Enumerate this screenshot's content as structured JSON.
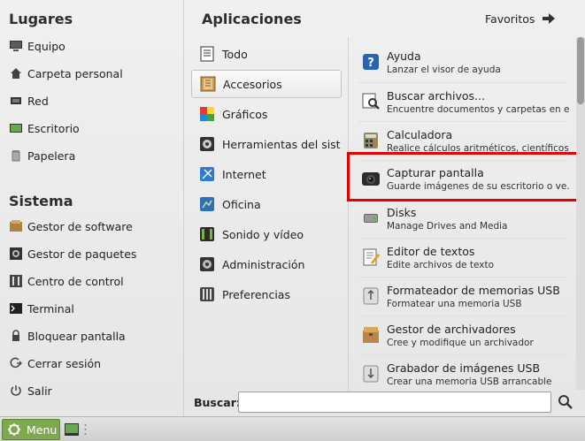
{
  "places": {
    "title": "Lugares",
    "items": [
      {
        "label": "Equipo",
        "icon": "computer-icon"
      },
      {
        "label": "Carpeta personal",
        "icon": "home-icon"
      },
      {
        "label": "Red",
        "icon": "network-icon"
      },
      {
        "label": "Escritorio",
        "icon": "desktop-icon"
      },
      {
        "label": "Papelera",
        "icon": "trash-icon"
      }
    ]
  },
  "system": {
    "title": "Sistema",
    "items": [
      {
        "label": "Gestor de software",
        "icon": "software-manager-icon"
      },
      {
        "label": "Gestor de paquetes",
        "icon": "package-manager-icon"
      },
      {
        "label": "Centro de control",
        "icon": "control-center-icon"
      },
      {
        "label": "Terminal",
        "icon": "terminal-icon"
      },
      {
        "label": "Bloquear pantalla",
        "icon": "lock-icon"
      },
      {
        "label": "Cerrar sesión",
        "icon": "logout-icon"
      },
      {
        "label": "Salir",
        "icon": "power-icon"
      }
    ]
  },
  "apps_header": {
    "title": "Aplicaciones",
    "favorites_label": "Favoritos"
  },
  "categories": [
    {
      "label": "Todo",
      "icon": "all-apps-icon"
    },
    {
      "label": "Accesorios",
      "icon": "accessories-icon",
      "selected": true
    },
    {
      "label": "Gráficos",
      "icon": "graphics-icon"
    },
    {
      "label": "Herramientas del sist...",
      "icon": "system-tools-icon"
    },
    {
      "label": "Internet",
      "icon": "internet-icon"
    },
    {
      "label": "Oficina",
      "icon": "office-icon"
    },
    {
      "label": "Sonido y vídeo",
      "icon": "sound-video-icon"
    },
    {
      "label": "Administración",
      "icon": "administration-icon"
    },
    {
      "label": "Preferencias",
      "icon": "preferences-icon"
    }
  ],
  "apps": [
    {
      "name": "Ayuda",
      "desc": "Lanzar el visor de ayuda",
      "icon": "help-icon"
    },
    {
      "name": "Buscar archivos...",
      "desc": "Encuentre documentos y carpetas en e...",
      "icon": "search-files-icon"
    },
    {
      "name": "Calculadora",
      "desc": "Realice cálculos aritméticos, científicos...",
      "icon": "calculator-icon"
    },
    {
      "name": "Capturar pantalla",
      "desc": "Guarde imágenes de su escritorio o ve...",
      "icon": "screenshot-icon"
    },
    {
      "name": "Disks",
      "desc": "Manage Drives and Media",
      "icon": "disks-icon"
    },
    {
      "name": "Editor de textos",
      "desc": "Edite archivos de texto",
      "icon": "text-editor-icon"
    },
    {
      "name": "Formateador de memorias USB",
      "desc": "Formatear una memoria USB",
      "icon": "usb-formatter-icon"
    },
    {
      "name": "Gestor de archivadores",
      "desc": "Cree y modifique un archivador",
      "icon": "archive-manager-icon"
    },
    {
      "name": "Grabador de imágenes USB",
      "desc": "Crear una memoria USB arrancable",
      "icon": "usb-writer-icon"
    }
  ],
  "search": {
    "label": "Buscar:",
    "value": ""
  },
  "panel": {
    "menu_label": "Menu"
  },
  "colors": {
    "highlight": "#e10000",
    "menu_button": "#7fa94e"
  }
}
